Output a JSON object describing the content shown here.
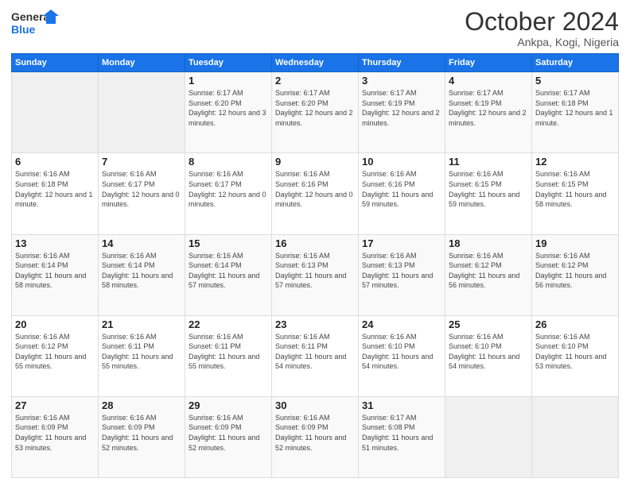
{
  "logo": {
    "line1": "General",
    "line2": "Blue"
  },
  "title": "October 2024",
  "location": "Ankpa, Kogi, Nigeria",
  "days_header": [
    "Sunday",
    "Monday",
    "Tuesday",
    "Wednesday",
    "Thursday",
    "Friday",
    "Saturday"
  ],
  "weeks": [
    [
      {
        "day": "",
        "info": ""
      },
      {
        "day": "",
        "info": ""
      },
      {
        "day": "1",
        "info": "Sunrise: 6:17 AM\nSunset: 6:20 PM\nDaylight: 12 hours and 3 minutes."
      },
      {
        "day": "2",
        "info": "Sunrise: 6:17 AM\nSunset: 6:20 PM\nDaylight: 12 hours and 2 minutes."
      },
      {
        "day": "3",
        "info": "Sunrise: 6:17 AM\nSunset: 6:19 PM\nDaylight: 12 hours and 2 minutes."
      },
      {
        "day": "4",
        "info": "Sunrise: 6:17 AM\nSunset: 6:19 PM\nDaylight: 12 hours and 2 minutes."
      },
      {
        "day": "5",
        "info": "Sunrise: 6:17 AM\nSunset: 6:18 PM\nDaylight: 12 hours and 1 minute."
      }
    ],
    [
      {
        "day": "6",
        "info": "Sunrise: 6:16 AM\nSunset: 6:18 PM\nDaylight: 12 hours and 1 minute."
      },
      {
        "day": "7",
        "info": "Sunrise: 6:16 AM\nSunset: 6:17 PM\nDaylight: 12 hours and 0 minutes."
      },
      {
        "day": "8",
        "info": "Sunrise: 6:16 AM\nSunset: 6:17 PM\nDaylight: 12 hours and 0 minutes."
      },
      {
        "day": "9",
        "info": "Sunrise: 6:16 AM\nSunset: 6:16 PM\nDaylight: 12 hours and 0 minutes."
      },
      {
        "day": "10",
        "info": "Sunrise: 6:16 AM\nSunset: 6:16 PM\nDaylight: 11 hours and 59 minutes."
      },
      {
        "day": "11",
        "info": "Sunrise: 6:16 AM\nSunset: 6:15 PM\nDaylight: 11 hours and 59 minutes."
      },
      {
        "day": "12",
        "info": "Sunrise: 6:16 AM\nSunset: 6:15 PM\nDaylight: 11 hours and 58 minutes."
      }
    ],
    [
      {
        "day": "13",
        "info": "Sunrise: 6:16 AM\nSunset: 6:14 PM\nDaylight: 11 hours and 58 minutes."
      },
      {
        "day": "14",
        "info": "Sunrise: 6:16 AM\nSunset: 6:14 PM\nDaylight: 11 hours and 58 minutes."
      },
      {
        "day": "15",
        "info": "Sunrise: 6:16 AM\nSunset: 6:14 PM\nDaylight: 11 hours and 57 minutes."
      },
      {
        "day": "16",
        "info": "Sunrise: 6:16 AM\nSunset: 6:13 PM\nDaylight: 11 hours and 57 minutes."
      },
      {
        "day": "17",
        "info": "Sunrise: 6:16 AM\nSunset: 6:13 PM\nDaylight: 11 hours and 57 minutes."
      },
      {
        "day": "18",
        "info": "Sunrise: 6:16 AM\nSunset: 6:12 PM\nDaylight: 11 hours and 56 minutes."
      },
      {
        "day": "19",
        "info": "Sunrise: 6:16 AM\nSunset: 6:12 PM\nDaylight: 11 hours and 56 minutes."
      }
    ],
    [
      {
        "day": "20",
        "info": "Sunrise: 6:16 AM\nSunset: 6:12 PM\nDaylight: 11 hours and 55 minutes."
      },
      {
        "day": "21",
        "info": "Sunrise: 6:16 AM\nSunset: 6:11 PM\nDaylight: 11 hours and 55 minutes."
      },
      {
        "day": "22",
        "info": "Sunrise: 6:16 AM\nSunset: 6:11 PM\nDaylight: 11 hours and 55 minutes."
      },
      {
        "day": "23",
        "info": "Sunrise: 6:16 AM\nSunset: 6:11 PM\nDaylight: 11 hours and 54 minutes."
      },
      {
        "day": "24",
        "info": "Sunrise: 6:16 AM\nSunset: 6:10 PM\nDaylight: 11 hours and 54 minutes."
      },
      {
        "day": "25",
        "info": "Sunrise: 6:16 AM\nSunset: 6:10 PM\nDaylight: 11 hours and 54 minutes."
      },
      {
        "day": "26",
        "info": "Sunrise: 6:16 AM\nSunset: 6:10 PM\nDaylight: 11 hours and 53 minutes."
      }
    ],
    [
      {
        "day": "27",
        "info": "Sunrise: 6:16 AM\nSunset: 6:09 PM\nDaylight: 11 hours and 53 minutes."
      },
      {
        "day": "28",
        "info": "Sunrise: 6:16 AM\nSunset: 6:09 PM\nDaylight: 11 hours and 52 minutes."
      },
      {
        "day": "29",
        "info": "Sunrise: 6:16 AM\nSunset: 6:09 PM\nDaylight: 11 hours and 52 minutes."
      },
      {
        "day": "30",
        "info": "Sunrise: 6:16 AM\nSunset: 6:09 PM\nDaylight: 11 hours and 52 minutes."
      },
      {
        "day": "31",
        "info": "Sunrise: 6:17 AM\nSunset: 6:08 PM\nDaylight: 11 hours and 51 minutes."
      },
      {
        "day": "",
        "info": ""
      },
      {
        "day": "",
        "info": ""
      }
    ]
  ]
}
